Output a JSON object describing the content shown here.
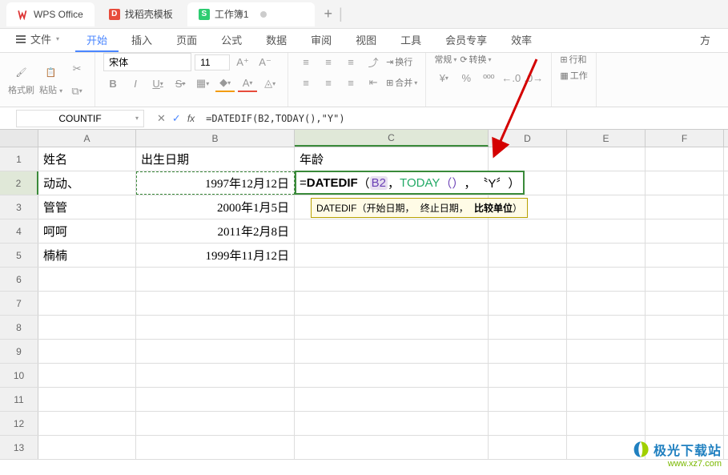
{
  "titlebar": {
    "tabs": [
      {
        "label": "WPS Office",
        "icon": "wps"
      },
      {
        "label": "找稻壳模板",
        "icon": "d"
      },
      {
        "label": "工作簿1",
        "icon": "s"
      }
    ],
    "newtab": "+"
  },
  "menubar": {
    "filemenu": "文件",
    "items": [
      "开始",
      "插入",
      "页面",
      "公式",
      "数据",
      "审阅",
      "视图",
      "工具",
      "会员专享",
      "效率"
    ],
    "active": "开始",
    "right": "方"
  },
  "ribbon": {
    "clipboard": {
      "format": "格式刷",
      "paste": "粘贴"
    },
    "font": {
      "name": "宋体",
      "size": "11"
    },
    "number": {
      "format": "常规",
      "convert": "转换"
    },
    "align": {
      "wrap": "换行",
      "merge": "合并"
    },
    "rightpane": {
      "rowcol": "行和",
      "worksheet": "工作"
    }
  },
  "formulabar": {
    "namebox": "COUNTIF",
    "formula": "=DATEDIF(B2,TODAY(),\"Y\")"
  },
  "columns": [
    "A",
    "B",
    "C",
    "D",
    "E",
    "F"
  ],
  "rows": [
    "1",
    "2",
    "3",
    "4",
    "5",
    "6",
    "7",
    "8",
    "9",
    "10",
    "11",
    "12",
    "13"
  ],
  "cells": {
    "A1": "姓名",
    "B1": "出生日期",
    "C1": "年龄",
    "A2": "动动、",
    "B2": "1997年12月12日",
    "A3": "管管",
    "B3": "2000年1月5日",
    "A4": "呵呵",
    "B4": "2011年2月8日",
    "A5": "楠楠",
    "B5": "1999年11月12日"
  },
  "edit": {
    "prefix": "=",
    "fn": "DATEDIF",
    "lp": "（",
    "ref": "B2",
    "c1": "，",
    "kw": "TODAY",
    "pp": "（）",
    "c2": "，",
    "str": "〝Y〞",
    "rp": "）"
  },
  "tooltip": {
    "fn": "DATEDIF",
    "lp": "（",
    "a1": "开始日期，",
    "a2": "终止日期，",
    "a3": "比较单位",
    "rp": "）"
  },
  "watermark": {
    "text": "极光下载站",
    "url": "www.xz7.com"
  }
}
